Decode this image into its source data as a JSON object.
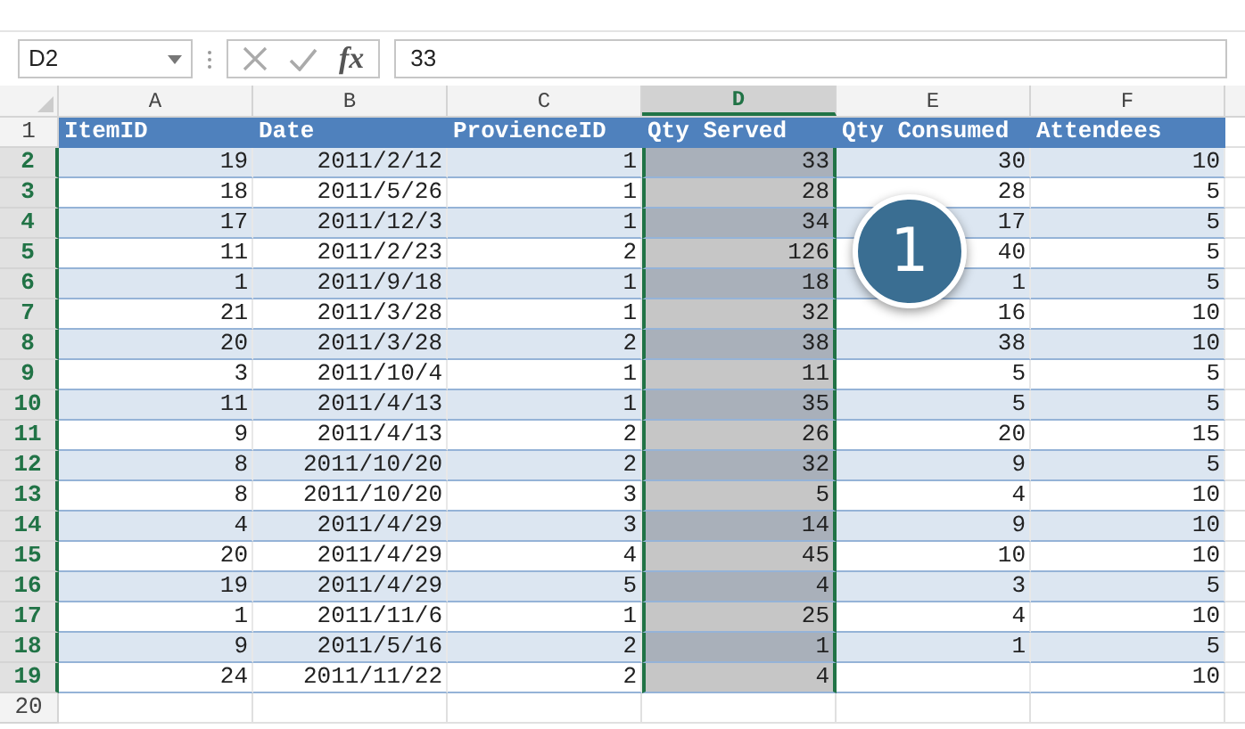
{
  "name_box": "D2",
  "formula_bar": {
    "function_label": "fx",
    "value": "33"
  },
  "columns": [
    {
      "label": "A",
      "selected": false
    },
    {
      "label": "B",
      "selected": false
    },
    {
      "label": "C",
      "selected": false
    },
    {
      "label": "D",
      "selected": true
    },
    {
      "label": "E",
      "selected": false
    },
    {
      "label": "F",
      "selected": false
    }
  ],
  "rows": [
    {
      "number": "1",
      "kind": "header",
      "selected": false,
      "cells": [
        "ItemID",
        "Date",
        "ProvienceID",
        "Qty Served",
        "Qty Consumed",
        "Attendees"
      ]
    },
    {
      "number": "2",
      "kind": "data",
      "selected": true,
      "cells": [
        "19",
        "2011/2/12",
        "1",
        "33",
        "30",
        "10"
      ]
    },
    {
      "number": "3",
      "kind": "data",
      "selected": true,
      "cells": [
        "18",
        "2011/5/26",
        "1",
        "28",
        "28",
        "5"
      ]
    },
    {
      "number": "4",
      "kind": "data",
      "selected": true,
      "cells": [
        "17",
        "2011/12/3",
        "1",
        "34",
        "17",
        "5"
      ]
    },
    {
      "number": "5",
      "kind": "data",
      "selected": true,
      "cells": [
        "11",
        "2011/2/23",
        "2",
        "126",
        "40",
        "5"
      ]
    },
    {
      "number": "6",
      "kind": "data",
      "selected": true,
      "cells": [
        "1",
        "2011/9/18",
        "1",
        "18",
        "1",
        "5"
      ]
    },
    {
      "number": "7",
      "kind": "data",
      "selected": true,
      "cells": [
        "21",
        "2011/3/28",
        "1",
        "32",
        "16",
        "10"
      ]
    },
    {
      "number": "8",
      "kind": "data",
      "selected": true,
      "cells": [
        "20",
        "2011/3/28",
        "2",
        "38",
        "38",
        "10"
      ]
    },
    {
      "number": "9",
      "kind": "data",
      "selected": true,
      "cells": [
        "3",
        "2011/10/4",
        "1",
        "11",
        "5",
        "5"
      ]
    },
    {
      "number": "10",
      "kind": "data",
      "selected": true,
      "cells": [
        "11",
        "2011/4/13",
        "1",
        "35",
        "5",
        "5"
      ]
    },
    {
      "number": "11",
      "kind": "data",
      "selected": true,
      "cells": [
        "9",
        "2011/4/13",
        "2",
        "26",
        "20",
        "15"
      ]
    },
    {
      "number": "12",
      "kind": "data",
      "selected": true,
      "cells": [
        "8",
        "2011/10/20",
        "2",
        "32",
        "9",
        "5"
      ]
    },
    {
      "number": "13",
      "kind": "data",
      "selected": true,
      "cells": [
        "8",
        "2011/10/20",
        "3",
        "5",
        "4",
        "10"
      ]
    },
    {
      "number": "14",
      "kind": "data",
      "selected": true,
      "cells": [
        "4",
        "2011/4/29",
        "3",
        "14",
        "9",
        "10"
      ]
    },
    {
      "number": "15",
      "kind": "data",
      "selected": true,
      "cells": [
        "20",
        "2011/4/29",
        "4",
        "45",
        "10",
        "10"
      ]
    },
    {
      "number": "16",
      "kind": "data",
      "selected": true,
      "cells": [
        "19",
        "2011/4/29",
        "5",
        "4",
        "3",
        "5"
      ]
    },
    {
      "number": "17",
      "kind": "data",
      "selected": true,
      "cells": [
        "1",
        "2011/11/6",
        "1",
        "25",
        "4",
        "10"
      ]
    },
    {
      "number": "18",
      "kind": "data",
      "selected": true,
      "cells": [
        "9",
        "2011/5/16",
        "2",
        "1",
        "1",
        "5"
      ]
    },
    {
      "number": "19",
      "kind": "data",
      "selected": true,
      "cells": [
        "24",
        "2011/11/22",
        "2",
        "4",
        "",
        "10"
      ]
    },
    {
      "number": "20",
      "kind": "empty",
      "selected": false,
      "cells": []
    }
  ],
  "callout": "1"
}
